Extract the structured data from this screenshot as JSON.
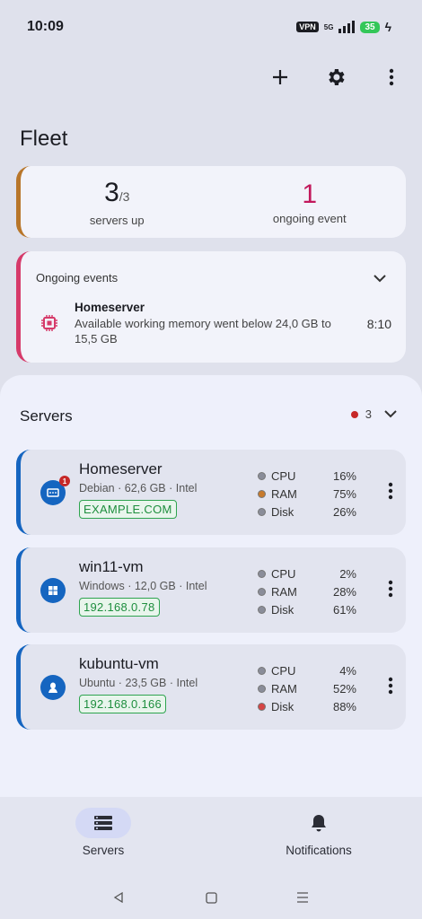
{
  "status_bar": {
    "time": "10:09",
    "vpn": "VPN",
    "network": "5G",
    "battery": "35"
  },
  "toolbar": {
    "add": "add-icon",
    "settings": "gear-icon",
    "more": "more-vert-icon"
  },
  "page": {
    "title": "Fleet"
  },
  "summary": {
    "servers_up": "3",
    "servers_total": "/3",
    "servers_label": "servers up",
    "events_count": "1",
    "events_label": "ongoing event",
    "accent": "#b8762a"
  },
  "events": {
    "header": "Ongoing events",
    "items": [
      {
        "host": "Homeserver",
        "message": "Available working memory went below 24,0 GB to 15,5 GB",
        "time": "8:10"
      }
    ]
  },
  "servers": {
    "title": "Servers",
    "count": "3",
    "items": [
      {
        "name": "Homeserver",
        "os": "Debian",
        "memory": "62,6 GB",
        "cpu_vendor": "Intel",
        "address": "EXAMPLE.COM",
        "alerts": "1",
        "cpu": "16%",
        "ram": "75%",
        "disk": "26%",
        "cpu_status": "#8a8d99",
        "ram_status": "#c77a2c",
        "disk_status": "#8a8d99"
      },
      {
        "name": "win11-vm",
        "os": "Windows",
        "memory": "12,0 GB",
        "cpu_vendor": "Intel",
        "address": "192.168.0.78",
        "cpu": "2%",
        "ram": "28%",
        "disk": "61%",
        "cpu_status": "#8a8d99",
        "ram_status": "#8a8d99",
        "disk_status": "#8a8d99"
      },
      {
        "name": "kubuntu-vm",
        "os": "Ubuntu",
        "memory": "23,5 GB",
        "cpu_vendor": "Intel",
        "address": "192.168.0.166",
        "cpu": "4%",
        "ram": "52%",
        "disk": "88%",
        "cpu_status": "#8a8d99",
        "ram_status": "#8a8d99",
        "disk_status": "#d64545"
      }
    ],
    "metric_labels": {
      "cpu": "CPU",
      "ram": "RAM",
      "disk": "Disk"
    },
    "separator": "·"
  },
  "bottom_nav": {
    "servers": "Servers",
    "notifications": "Notifications"
  }
}
